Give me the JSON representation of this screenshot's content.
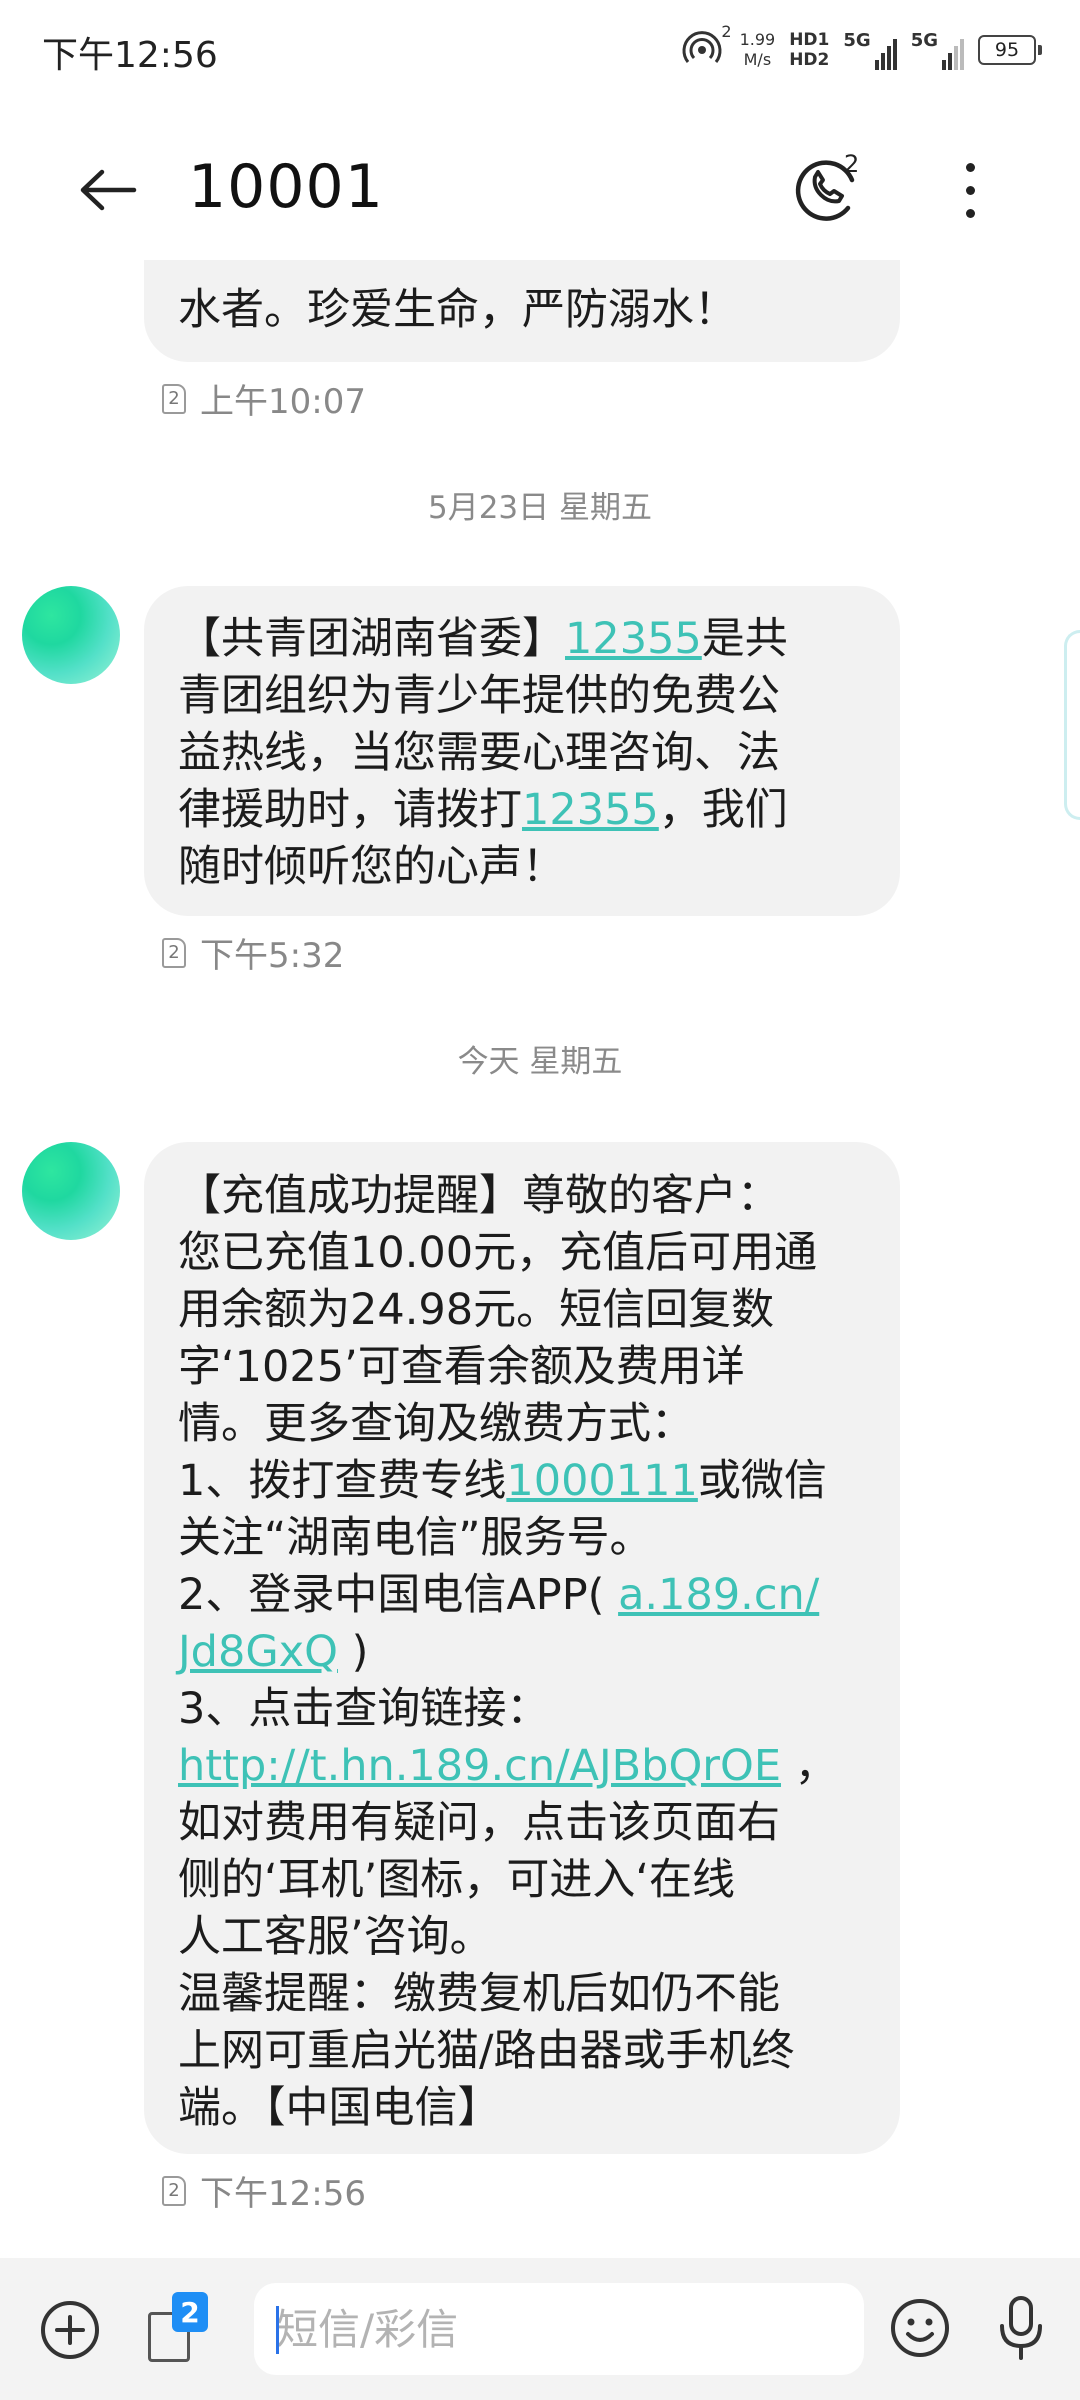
{
  "status_bar": {
    "time": "下午12:56",
    "wifi_sub": "2",
    "speed_value": "1.99",
    "speed_unit": "M/s",
    "hd1": "HD1",
    "hd2": "HD2",
    "sig1_label": "5G",
    "sig2_label": "5G",
    "battery": "95"
  },
  "header": {
    "title": "10001",
    "call_sim_badge": "2"
  },
  "messages": [
    {
      "lines": [
        "水者。珍爱生命，严防溺水！"
      ],
      "time": "上午10:07",
      "sim": "2"
    },
    {
      "date": "5月23日 星期五",
      "lines": [
        [
          {
            "t": "【共青团湖南省委】"
          },
          {
            "t": "12355",
            "link": true
          },
          {
            "t": "是共"
          }
        ],
        "青团组织为青少年提供的免费公",
        "益热线，当您需要心理咨询、法",
        [
          {
            "t": "律援助时，请拨打"
          },
          {
            "t": "12355",
            "link": true
          },
          {
            "t": "，我们"
          }
        ],
        "随时倾听您的心声！"
      ],
      "time": "下午5:32",
      "sim": "2"
    },
    {
      "date": "今天 星期五",
      "lines": [
        "【充值成功提醒】尊敬的客户：",
        "您已充值10.00元，充值后可用通",
        "用余额为24.98元。短信回复数",
        "字‘1025’可查看余额及费用详",
        "情。更多查询及缴费方式：",
        [
          {
            "t": "1、拨打查费专线"
          },
          {
            "t": "1000111",
            "link": true
          },
          {
            "t": "或微信"
          }
        ],
        "关注“湖南电信”服务号。",
        [
          {
            "t": "2、登录中国电信APP( "
          },
          {
            "t": "a.189.cn/",
            "link": true
          }
        ],
        [
          {
            "t": "Jd8GxQ",
            "link": true
          },
          {
            "t": " )"
          }
        ],
        "3、点击查询链接：",
        [
          {
            "t": "http://t.hn.189.cn/AJBbQrOE",
            "link": true
          },
          {
            "t": " ，"
          }
        ],
        "如对费用有疑问，点击该页面右",
        "侧的‘耳机’图标，可进入‘在线",
        "人工客服’咨询。",
        "温馨提醒：缴费复机后如仍不能",
        "上网可重启光猫/路由器或手机终",
        "端。【中国电信】"
      ],
      "time": "下午12:56",
      "sim": "2"
    }
  ],
  "input_bar": {
    "placeholder": "短信/彩信",
    "sim_badge": "2"
  }
}
